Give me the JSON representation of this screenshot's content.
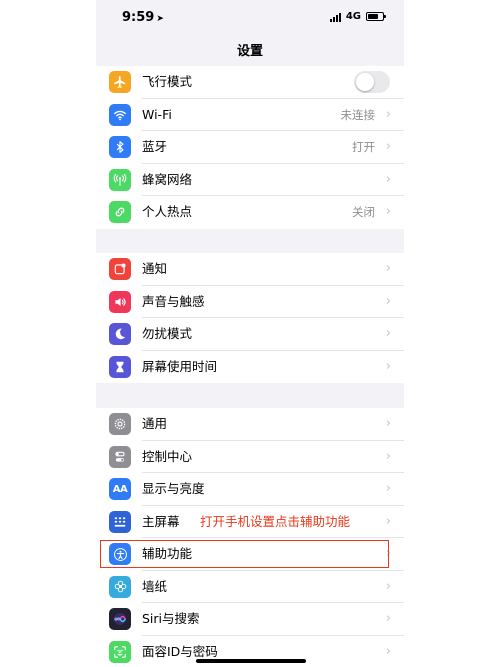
{
  "status_bar": {
    "time": "9:59",
    "network": "4G"
  },
  "nav": {
    "title": "设置"
  },
  "groups": [
    {
      "items": [
        {
          "label": "飞行模式",
          "icon": "airplane-icon",
          "color": "#f5a623",
          "toggle": "off"
        },
        {
          "label": "Wi-Fi",
          "icon": "wifi-icon",
          "color": "#2f7cf6",
          "value": "未连接"
        },
        {
          "label": "蓝牙",
          "icon": "bluetooth-icon",
          "color": "#2f7cf6",
          "value": "打开"
        },
        {
          "label": "蜂窝网络",
          "icon": "cellular-icon",
          "color": "#4cd964",
          "value": ""
        },
        {
          "label": "个人热点",
          "icon": "hotspot-icon",
          "color": "#4cd964",
          "value": "关闭"
        }
      ]
    },
    {
      "items": [
        {
          "label": "通知",
          "icon": "notifications-icon",
          "color": "#f0443a"
        },
        {
          "label": "声音与触感",
          "icon": "sound-icon",
          "color": "#f0375a"
        },
        {
          "label": "勿扰模式",
          "icon": "moon-icon",
          "color": "#5856d6"
        },
        {
          "label": "屏幕使用时间",
          "icon": "hourglass-icon",
          "color": "#5856d6"
        }
      ]
    },
    {
      "items": [
        {
          "label": "通用",
          "icon": "gear-icon",
          "color": "#8e8e93"
        },
        {
          "label": "控制中心",
          "icon": "control-center-icon",
          "color": "#8e8e93"
        },
        {
          "label": "显示与亮度",
          "icon": "display-icon",
          "color": "#2f7cf6",
          "icon_text": "AA"
        },
        {
          "label": "主屏幕",
          "icon": "home-screen-icon",
          "color": "#2f64d8"
        },
        {
          "label": "辅助功能",
          "icon": "accessibility-icon",
          "color": "#2f7cf6"
        },
        {
          "label": "墙纸",
          "icon": "wallpaper-icon",
          "color": "#36aadc"
        },
        {
          "label": "Siri与搜索",
          "icon": "siri-icon",
          "color": "#222233"
        },
        {
          "label": "面容ID与密码",
          "icon": "face-id-icon",
          "color": "#4cd964"
        }
      ]
    }
  ],
  "annotation": {
    "text": "打开手机设置点击辅助功能",
    "color": "#e8391a"
  },
  "chevron": "›"
}
